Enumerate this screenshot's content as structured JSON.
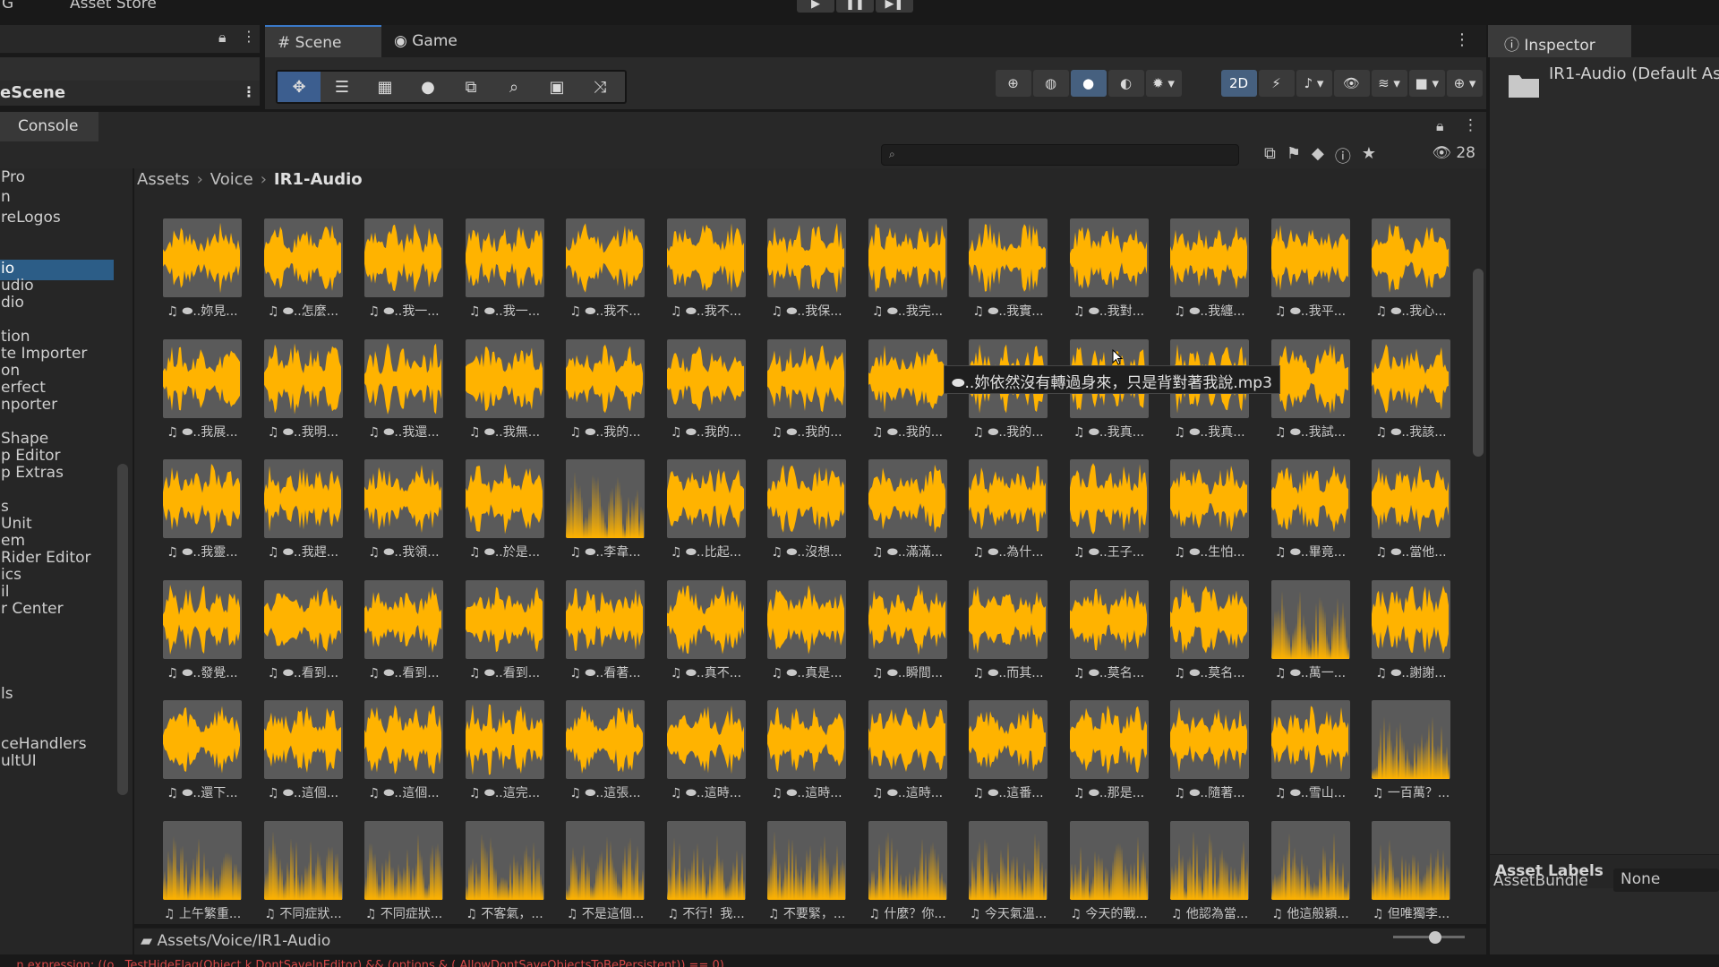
{
  "topbar": {
    "left_label": "G",
    "asset_store": "Asset Store"
  },
  "hierarchy": {
    "scene_name": "eScene"
  },
  "scene_view": {
    "tabs": [
      "Scene",
      "Game"
    ],
    "mode_2d": "2D"
  },
  "console": {
    "tab_label": "Console"
  },
  "project": {
    "search_placeholder": "",
    "visible_count": "28",
    "breadcrumb": [
      "Assets",
      "Voice",
      "IR1-Audio"
    ],
    "path": "Assets/Voice/IR1-Audio",
    "tree": [
      {
        "label": " Pro",
        "selected": false
      },
      {
        "label": "n",
        "selected": false
      },
      {
        "label": "reLogos",
        "selected": false
      },
      {
        "label": "io",
        "selected": true
      },
      {
        "label": "udio",
        "selected": false
      },
      {
        "label": "dio",
        "selected": false
      },
      {
        "label": "tion",
        "selected": false
      },
      {
        "label": "te Importer",
        "selected": false
      },
      {
        "label": "on",
        "selected": false
      },
      {
        "label": "erfect",
        "selected": false
      },
      {
        "label": "nporter",
        "selected": false
      },
      {
        "label": "Shape",
        "selected": false
      },
      {
        "label": "p Editor",
        "selected": false
      },
      {
        "label": "p Extras",
        "selected": false
      },
      {
        "label": "s",
        "selected": false
      },
      {
        "label": "Unit",
        "selected": false
      },
      {
        "label": "em",
        "selected": false
      },
      {
        "label": "Rider Editor",
        "selected": false
      },
      {
        "label": "ics",
        "selected": false
      },
      {
        "label": "il",
        "selected": false
      },
      {
        "label": "r Center",
        "selected": false
      },
      {
        "label": "ls",
        "selected": false
      },
      {
        "label": "ceHandlers",
        "selected": false
      },
      {
        "label": "ultUI",
        "selected": false
      }
    ],
    "files": [
      "♫ ⬬..妳見...",
      "♫ ⬬..怎麼...",
      "♫ ⬬..我一...",
      "♫ ⬬..我一...",
      "♫ ⬬..我不...",
      "♫ ⬬..我不...",
      "♫ ⬬..我保...",
      "♫ ⬬..我完...",
      "♫ ⬬..我實...",
      "♫ ⬬..我對...",
      "♫ ⬬..我纏...",
      "♫ ⬬..我平...",
      "♫ ⬬..我心...",
      "♫ ⬬..我展...",
      "♫ ⬬..我明...",
      "♫ ⬬..我還...",
      "♫ ⬬..我無...",
      "♫ ⬬..我的...",
      "♫ ⬬..我的...",
      "♫ ⬬..我的...",
      "♫ ⬬..我的...",
      "♫ ⬬..我的...",
      "♫ ⬬..我真...",
      "♫ ⬬..我真...",
      "♫ ⬬..我試...",
      "♫ ⬬..我該...",
      "♫ ⬬..我靈...",
      "♫ ⬬..我趕...",
      "♫ ⬬..我領...",
      "♫ ⬬..於是...",
      "♫ ⬬..李韋...",
      "♫ ⬬..比起...",
      "♫ ⬬..沒想...",
      "♫ ⬬..滿滿...",
      "♫ ⬬..為什...",
      "♫ ⬬..王子...",
      "♫ ⬬..生怕...",
      "♫ ⬬..畢竟...",
      "♫ ⬬..當他...",
      "♫ ⬬..發覺...",
      "♫ ⬬..看到...",
      "♫ ⬬..看到...",
      "♫ ⬬..看到...",
      "♫ ⬬..看著...",
      "♫ ⬬..真不...",
      "♫ ⬬..真是...",
      "♫ ⬬..瞬間...",
      "♫ ⬬..而其...",
      "♫ ⬬..莫名...",
      "♫ ⬬..莫名...",
      "♫ ⬬..萬一...",
      "♫ ⬬..謝謝...",
      "♫ ⬬..還下...",
      "♫ ⬬..這個...",
      "♫ ⬬..這個...",
      "♫ ⬬..這完...",
      "♫ ⬬..這張...",
      "♫ ⬬..這時...",
      "♫ ⬬..這時...",
      "♫ ⬬..這時...",
      "♫ ⬬..這番...",
      "♫ ⬬..那是...",
      "♫ ⬬..隨著...",
      "♫ ⬬..雪山...",
      "♫ 一百萬？...",
      "♫ 上午繁重...",
      "♫ 不同症狀...",
      "♫ 不同症狀...",
      "♫ 不客氣，...",
      "♫ 不是這個...",
      "♫ 不行！我...",
      "♫ 不要緊，...",
      "♫ 什麼？你...",
      "♫ 今天氣溫...",
      "♫ 今天的戰...",
      "♫ 他認為當...",
      "♫ 他這般穎...",
      "♫ 但唯獨李..."
    ],
    "tooltip": "⬬..妳依然沒有轉過身來，只是背對著我說.mp3"
  },
  "inspector": {
    "tab_label": "Inspector",
    "title": "IR1-Audio (Default As",
    "asset_labels": "Asset Labels",
    "assetbundle_label": "AssetBundle",
    "assetbundle_value": "None"
  },
  "error_text": "...n expression: ((o.. TestHideFlag(Object.k.DontSaveInEditor) && (options & (.AllowDontSaveObjectsToBePersistent)) == 0)",
  "colors": {
    "waveform": "#ffb300",
    "thumb_bg": "#5a5a5a",
    "selection": "#2c5d87"
  }
}
